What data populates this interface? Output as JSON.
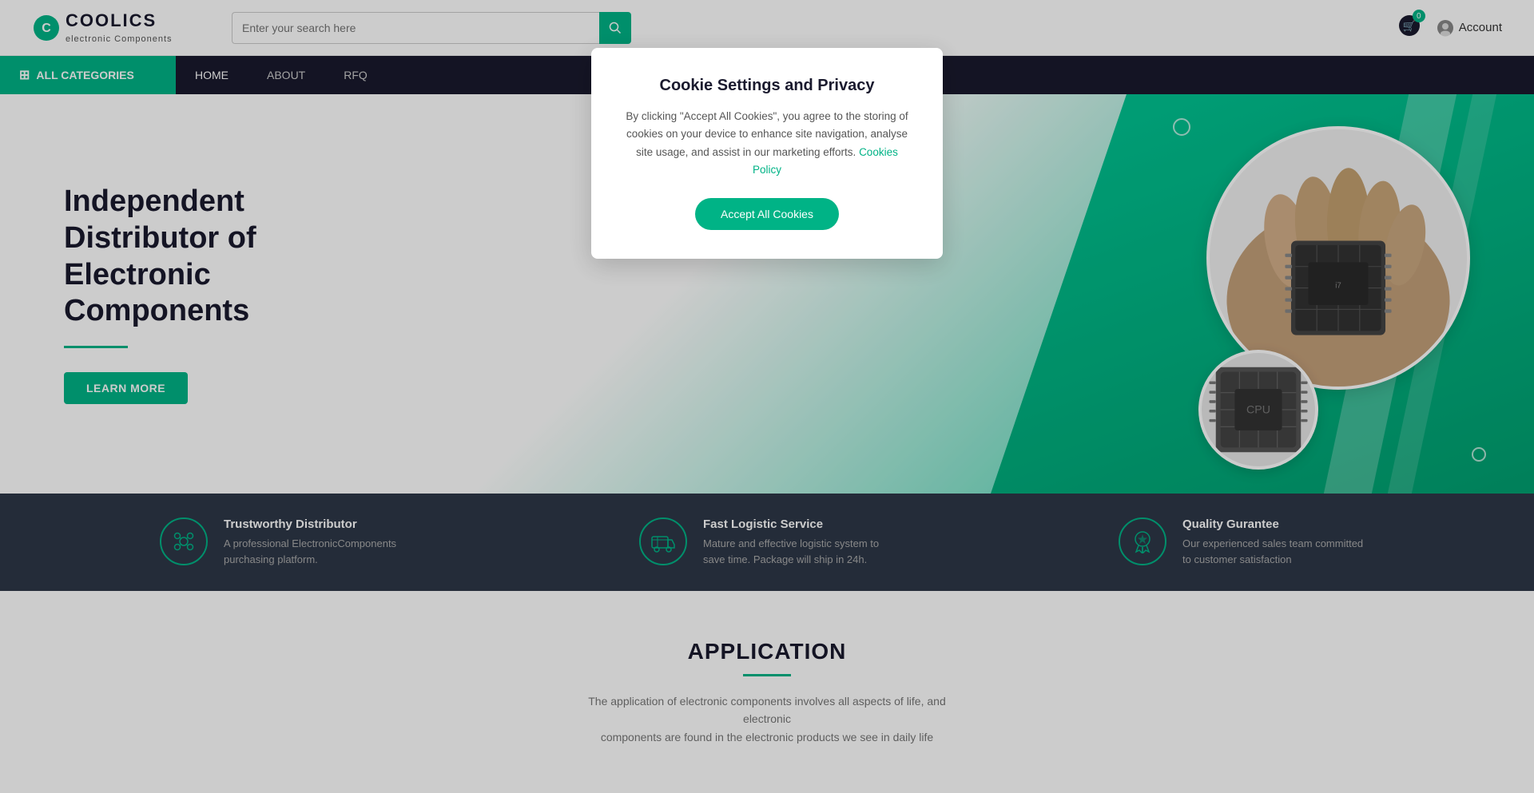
{
  "header": {
    "logo": {
      "brand": "COOLICS",
      "subtitle": "electronic Components"
    },
    "search": {
      "placeholder": "Enter your search here"
    },
    "cart": {
      "badge": "0"
    },
    "account_label": "Account"
  },
  "nav": {
    "categories_label": "ALL CATEGORIES",
    "links": [
      {
        "label": "HOME",
        "active": true
      },
      {
        "label": "ABOUT",
        "active": false
      },
      {
        "label": "RFQ",
        "active": false
      }
    ]
  },
  "hero": {
    "title_line1": "Independent Distributor of",
    "title_line2": "Electronic Components",
    "learn_more": "LEARN MORE"
  },
  "features": [
    {
      "id": "trustworthy",
      "title": "Trustworthy Distributor",
      "desc": "A professional ElectronicComponents purchasing platform."
    },
    {
      "id": "logistic",
      "title": "Fast Logistic Service",
      "desc": "Mature and effective logistic system to save time. Package will ship in 24h."
    },
    {
      "id": "quality",
      "title": "Quality Gurantee",
      "desc": "Our experienced sales team committed to customer satisfaction"
    }
  ],
  "application": {
    "title": "APPLICATION",
    "desc_line1": "The application of electronic components involves all aspects of life, and electronic",
    "desc_line2": "components are found in the electronic products we see in daily life"
  },
  "cookie": {
    "title": "Cookie Settings and Privacy",
    "body": "By clicking \"Accept All Cookies\", you agree to the storing of cookies on your device to enhance site navigation, analyse site usage, and assist in our marketing efforts.",
    "policy_link": "Cookies Policy",
    "accept_label": "Accept All Cookies"
  }
}
